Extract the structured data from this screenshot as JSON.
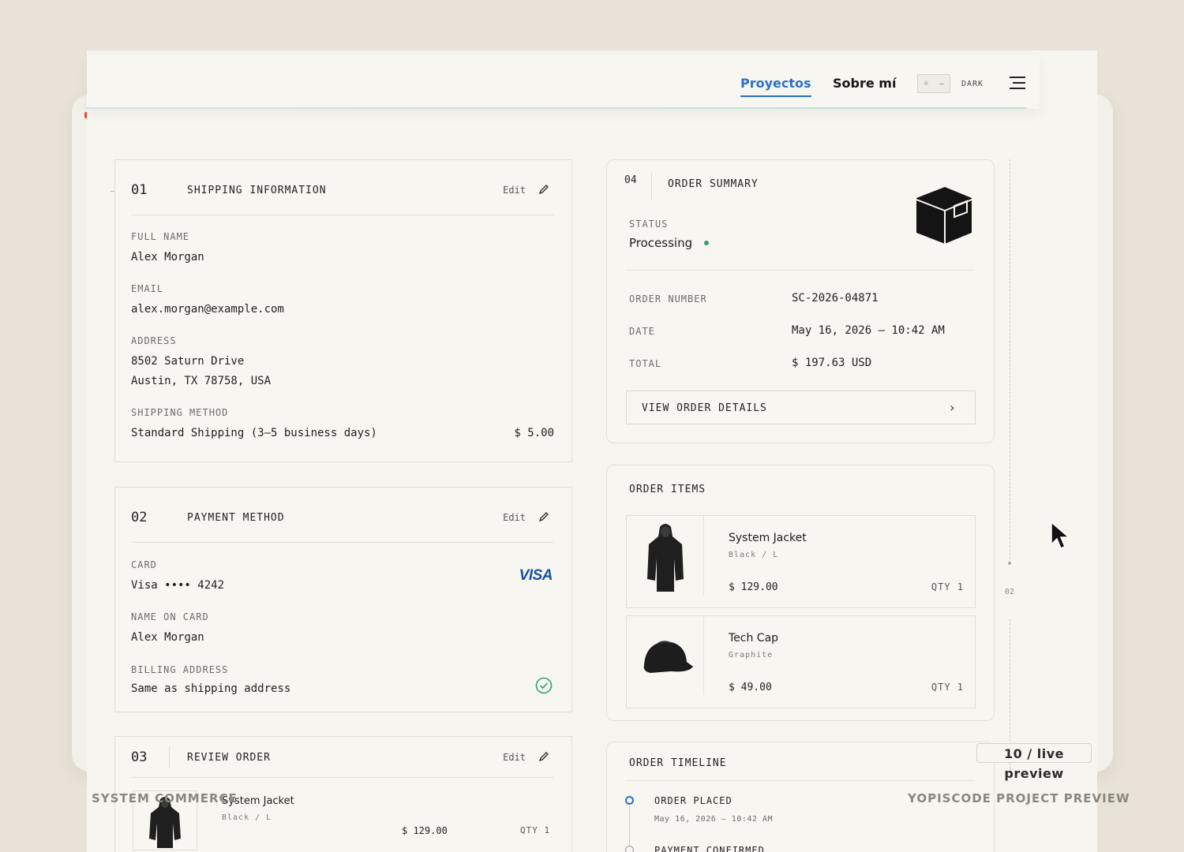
{
  "header": {
    "nav_projects": "Proyectos",
    "nav_about": "Sobre mí",
    "theme_label": "DARK"
  },
  "shipping": {
    "step": "01",
    "title": "SHIPPING INFORMATION",
    "edit": "Edit",
    "full_name_label": "FULL NAME",
    "full_name": "Alex Morgan",
    "email_label": "EMAIL",
    "email": "alex.morgan@example.com",
    "address_label": "ADDRESS",
    "address_line1": "8502 Saturn Drive",
    "address_line2": "Austin, TX 78758, USA",
    "method_label": "SHIPPING METHOD",
    "method": "Standard Shipping (3–5 business days)",
    "method_price": "$ 5.00"
  },
  "payment": {
    "step": "02",
    "title": "PAYMENT METHOD",
    "edit": "Edit",
    "card_label": "CARD",
    "card": "Visa •••• 4242",
    "card_brand": "VISA",
    "name_label": "NAME ON CARD",
    "name": "Alex Morgan",
    "billing_label": "BILLING ADDRESS",
    "billing": "Same as shipping address"
  },
  "review": {
    "step": "03",
    "title": "REVIEW ORDER",
    "edit": "Edit",
    "item_name": "System Jacket",
    "item_variant": "Black / L",
    "item_price": "$ 129.00",
    "item_qty": "QTY 1"
  },
  "summary": {
    "step": "04",
    "title": "ORDER SUMMARY",
    "status_label": "STATUS",
    "status": "Processing",
    "order_number_label": "ORDER NUMBER",
    "order_number": "SC-2026-04871",
    "date_label": "DATE",
    "date": "May 16, 2026 – 10:42 AM",
    "total_label": "TOTAL",
    "total": "$ 197.63 USD",
    "view_details": "VIEW ORDER DETAILS"
  },
  "items": {
    "title": "ORDER ITEMS",
    "list": [
      {
        "name": "System Jacket",
        "variant": "Black / L",
        "price": "$ 129.00",
        "qty": "QTY 1"
      },
      {
        "name": "Tech Cap",
        "variant": "Graphite",
        "price": "$ 49.00",
        "qty": "QTY 1"
      }
    ]
  },
  "timeline": {
    "title": "ORDER TIMELINE",
    "events": [
      {
        "label": "ORDER PLACED",
        "time": "May 16, 2026 – 10:42 AM"
      },
      {
        "label": "PAYMENT CONFIRMED",
        "time": ""
      }
    ]
  },
  "rail": {
    "label": "02"
  },
  "badge": "10 / live preview",
  "footer": {
    "left": "SYSTEM COMMERCE",
    "right": "YOPISCODE PROJECT PREVIEW"
  },
  "colors": {
    "accent": "#2a72c4",
    "status_dot": "#2fa36b",
    "check": "#2fa36b",
    "visa": "#1a4fa0"
  }
}
